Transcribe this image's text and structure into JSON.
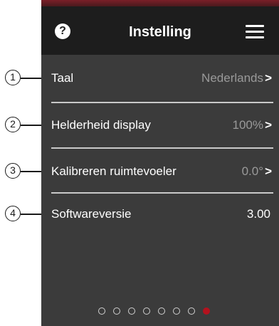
{
  "header": {
    "title": "Instelling",
    "help_icon": "?"
  },
  "rows": [
    {
      "label": "Taal",
      "value": "Nederlands",
      "chevron": ">"
    },
    {
      "label": "Helderheid display",
      "value": "100%",
      "chevron": ">"
    },
    {
      "label": "Kalibreren ruimtevoeler",
      "value": "0.0°",
      "chevron": ">"
    },
    {
      "label": "Softwareversie",
      "value": "3.00"
    }
  ],
  "callouts": [
    "1",
    "2",
    "3",
    "4"
  ],
  "pagination": {
    "total": 8,
    "active_index": 7
  },
  "colors": {
    "background": "#3b3b3b",
    "header": "#1d1d1d",
    "accent": "#b3121e",
    "muted_text": "#9a9a9a"
  }
}
